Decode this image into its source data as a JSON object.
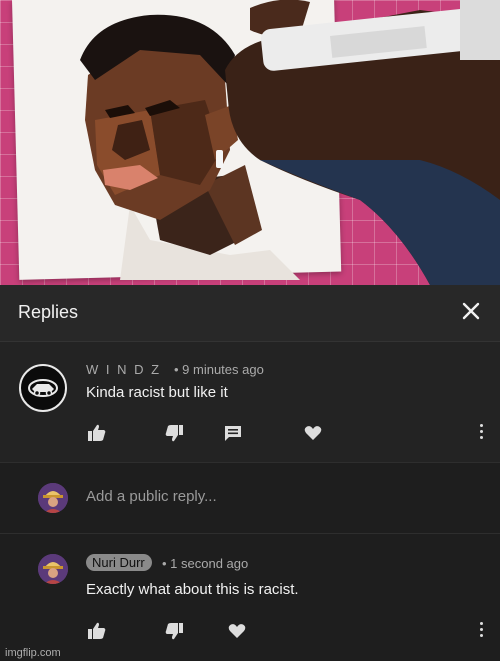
{
  "panel": {
    "title": "Replies",
    "close_icon": "close-icon"
  },
  "comment": {
    "author": "W I N D Z",
    "time": "• 9 minutes ago",
    "text": "Kinda racist but like it",
    "actions": [
      "like-icon",
      "dislike-icon",
      "reply-icon",
      "heart-icon",
      "more-vert-icon"
    ]
  },
  "reply_box": {
    "placeholder": "Add a public reply..."
  },
  "reply": {
    "author": "Nuri Durr",
    "time": "• 1 second ago",
    "text": "Exactly what about this is racist.",
    "actions": [
      "like-icon",
      "dislike-icon",
      "heart-icon",
      "more-vert-icon"
    ]
  },
  "watermark": "imgflip.com",
  "colors": {
    "panel_bg": "#1e1e1e",
    "header_bg": "#282828",
    "chip_bg": "#8a8a8a",
    "cutting_mat": "#c8407a"
  }
}
